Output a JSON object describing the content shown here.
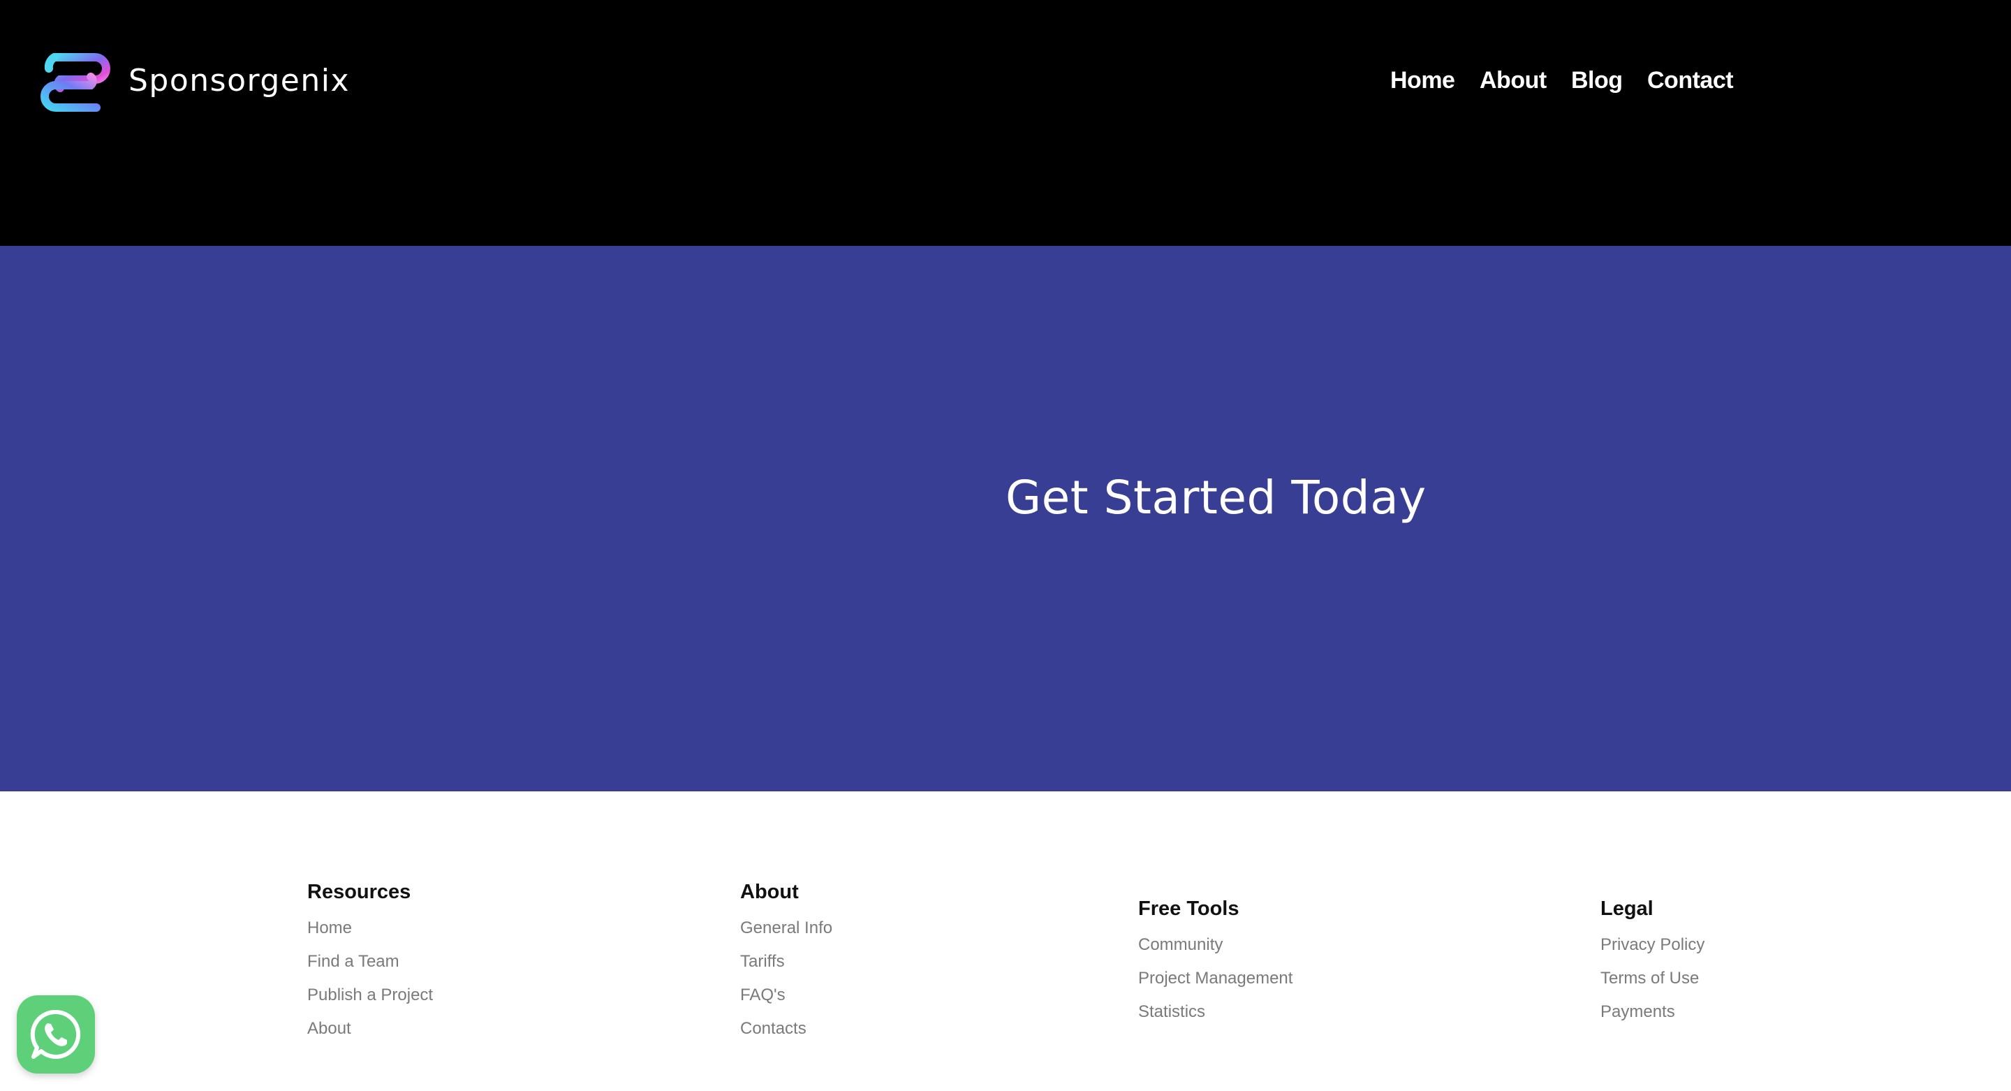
{
  "header": {
    "brand": "Sponsorgenix",
    "nav": [
      {
        "label": "Home"
      },
      {
        "label": "About"
      },
      {
        "label": "Blog"
      },
      {
        "label": "Contact"
      }
    ]
  },
  "hero": {
    "title": "Get Started Today"
  },
  "footer": {
    "columns": [
      {
        "heading": "Resources",
        "links": [
          "Home",
          "Find a Team",
          "Publish a Project",
          "About"
        ]
      },
      {
        "heading": "About",
        "links": [
          "General Info",
          "Tariffs",
          "FAQ's",
          "Contacts"
        ]
      },
      {
        "heading": "Free Tools",
        "links": [
          "Community",
          "Project Management",
          "Statistics"
        ]
      },
      {
        "heading": "Legal",
        "links": [
          "Privacy Policy",
          "Terms of Use",
          "Payments"
        ]
      }
    ]
  },
  "colors": {
    "header_bg": "#000000",
    "hero_bg": "#383e93",
    "whatsapp_green": "#5fd07a",
    "link_gray": "#7a7a7a"
  },
  "icons": {
    "logo": "sponsorgenix-logo-icon",
    "whatsapp": "whatsapp-icon"
  }
}
